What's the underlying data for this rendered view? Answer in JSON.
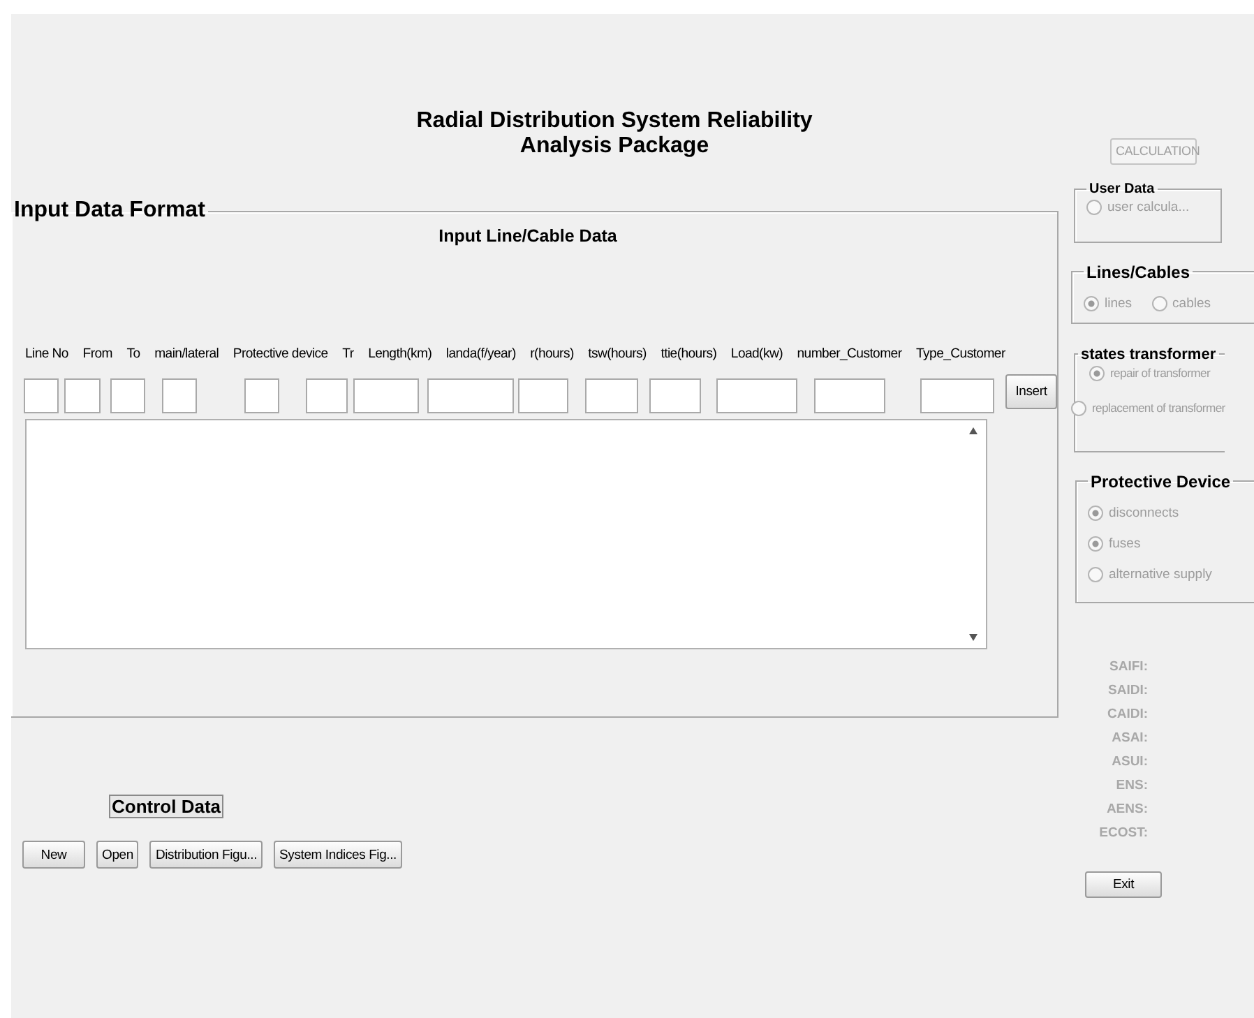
{
  "window": {
    "title": "Radial Distribution System Reliability Analysis Package"
  },
  "calculation_button": {
    "label": "CALCULATION",
    "disabled": true
  },
  "input_panel": {
    "title": "Input Data Format",
    "subtitle": "Input Line/Cable Data",
    "columns": [
      "Line No",
      "From",
      "To",
      "main/lateral",
      "Protective device",
      "Tr",
      "Length(km)",
      "landa(f/year)",
      "r(hours)",
      "tsw(hours)",
      "ttie(hours)",
      "Load(kw)",
      "number_Customer",
      "Type_Customer"
    ],
    "insert_button": {
      "label": "Insert",
      "disabled": false
    }
  },
  "control_data": {
    "title": "Control Data",
    "buttons": [
      {
        "label": "New",
        "disabled": false
      },
      {
        "label": "Open",
        "disabled": false
      },
      {
        "label": "Distribution Figu...",
        "disabled": false
      },
      {
        "label": "System Indices Fig...",
        "disabled": false
      }
    ]
  },
  "user_data": {
    "title": "User Data",
    "options": [
      {
        "label": "user calcula...",
        "selected": false,
        "disabled": true
      }
    ]
  },
  "lines_cables": {
    "title": "Lines/Cables",
    "options": [
      {
        "label": "lines",
        "selected": true,
        "disabled": true
      },
      {
        "label": "cables",
        "selected": false,
        "disabled": true
      }
    ]
  },
  "states_transformer": {
    "title": "states transformer",
    "options": [
      {
        "label": "repair of transformer",
        "selected": true,
        "disabled": true
      },
      {
        "label": "replacement of transformer",
        "selected": false,
        "disabled": true
      }
    ]
  },
  "protective_device": {
    "title": "Protective Device",
    "options": [
      {
        "label": "disconnects",
        "selected": true,
        "disabled": true
      },
      {
        "label": "fuses",
        "selected": true,
        "disabled": true
      },
      {
        "label": "alternative supply",
        "selected": false,
        "disabled": true
      }
    ]
  },
  "indices": [
    {
      "label": "SAIFI:"
    },
    {
      "label": "SAIDI:"
    },
    {
      "label": "CAIDI:"
    },
    {
      "label": "ASAI:"
    },
    {
      "label": "ASUI:"
    },
    {
      "label": "ENS:"
    },
    {
      "label": "AENS:"
    },
    {
      "label": "ECOST:"
    }
  ],
  "exit_button": {
    "label": "Exit",
    "disabled": false
  }
}
